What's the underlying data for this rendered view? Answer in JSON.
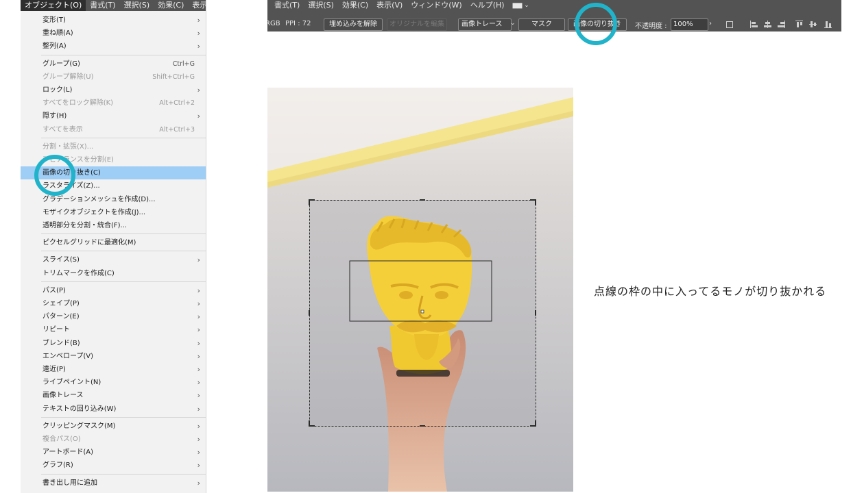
{
  "menubar": {
    "items": [
      {
        "label": "オブジェクト(O)",
        "active": true
      },
      {
        "label": "書式(T)"
      },
      {
        "label": "選択(S)"
      },
      {
        "label": "効果(C)"
      },
      {
        "label": "表示"
      }
    ]
  },
  "object_menu": {
    "items": [
      {
        "label": "変形(T)",
        "submenu": true
      },
      {
        "label": "重ね順(A)",
        "submenu": true
      },
      {
        "label": "整列(A)",
        "submenu": true
      },
      {
        "separator": true
      },
      {
        "label": "グループ(G)",
        "shortcut": "Ctrl+G"
      },
      {
        "label": "グループ解除(U)",
        "shortcut": "Shift+Ctrl+G",
        "disabled": true
      },
      {
        "label": "ロック(L)",
        "submenu": true
      },
      {
        "label": "すべてをロック解除(K)",
        "shortcut": "Alt+Ctrl+2",
        "disabled": true
      },
      {
        "label": "隠す(H)",
        "submenu": true
      },
      {
        "label": "すべてを表示",
        "shortcut": "Alt+Ctrl+3",
        "disabled": true
      },
      {
        "separator": true
      },
      {
        "label": "分割・拡張(X)...",
        "disabled": true
      },
      {
        "label": "アピアランスを分割(E)",
        "disabled": true
      },
      {
        "label": "画像の切り抜き(C)",
        "selected": true
      },
      {
        "label": "ラスタライズ(Z)..."
      },
      {
        "label": "グラデーションメッシュを作成(D)..."
      },
      {
        "label": "モザイクオブジェクトを作成(J)..."
      },
      {
        "label": "透明部分を分割・統合(F)..."
      },
      {
        "separator": true
      },
      {
        "label": "ピクセルグリッドに最適化(M)"
      },
      {
        "separator": true
      },
      {
        "label": "スライス(S)",
        "submenu": true
      },
      {
        "label": "トリムマークを作成(C)"
      },
      {
        "separator": true
      },
      {
        "label": "パス(P)",
        "submenu": true
      },
      {
        "label": "シェイプ(P)",
        "submenu": true
      },
      {
        "label": "パターン(E)",
        "submenu": true
      },
      {
        "label": "リピート",
        "submenu": true
      },
      {
        "label": "ブレンド(B)",
        "submenu": true
      },
      {
        "label": "エンベロープ(V)",
        "submenu": true
      },
      {
        "label": "遠近(P)",
        "submenu": true
      },
      {
        "label": "ライブペイント(N)",
        "submenu": true
      },
      {
        "label": "画像トレース",
        "submenu": true
      },
      {
        "label": "テキストの回り込み(W)",
        "submenu": true
      },
      {
        "separator": true
      },
      {
        "label": "クリッピングマスク(M)",
        "submenu": true
      },
      {
        "label": "複合パス(O)",
        "submenu": true,
        "disabled": true
      },
      {
        "label": "アートボード(A)",
        "submenu": true
      },
      {
        "label": "グラフ(R)",
        "submenu": true
      },
      {
        "separator": true
      },
      {
        "label": "書き出し用に追加",
        "submenu": true
      }
    ]
  },
  "top_bar": {
    "menus": [
      "書式(T)",
      "選択(S)",
      "効果(C)",
      "表示(V)",
      "ウィンドウ(W)",
      "ヘルプ(H)"
    ],
    "color_mode": "RGB",
    "ppi_label": "PPI : 72",
    "embed_button": "埋め込みを解除",
    "edit_original_button": "オリジナルを編集",
    "image_trace_select": "画像トレース",
    "mask_button": "マスク",
    "crop_image_button": "画像の切り抜き",
    "opacity_label": "不透明度 :",
    "opacity_value": "100%"
  },
  "main_text": "点線の枠の中に入ってるモノが切り抜かれる",
  "colors": {
    "menu_highlight": "#9ecdf5",
    "callout_circle": "#20b3c9",
    "statue_yellow": "#f5cf3a",
    "bar_dark": "#535353"
  }
}
